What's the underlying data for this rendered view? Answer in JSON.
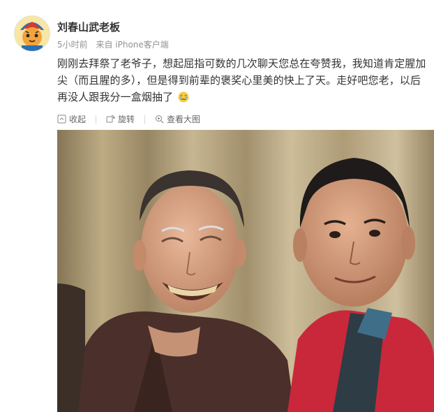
{
  "post": {
    "author": "刘春山武老板",
    "time": "5小时前",
    "source": "来自 iPhone客户端",
    "text": "刚刚去拜祭了老爷子，想起屈指可数的几次聊天您总在夸赞我，我知道肯定腥加尖（而且腥的多），但是得到前辈的褒奖心里美的快上了天。走好吧您老，以后再没人跟我分一盒烟抽了",
    "emoji": "crying-emoji"
  },
  "toolbar": {
    "collapse": "收起",
    "rotate": "旋转",
    "view_large": "查看大图"
  },
  "photo": {
    "alt_subject": "two-men-selfie",
    "watermark": ""
  }
}
